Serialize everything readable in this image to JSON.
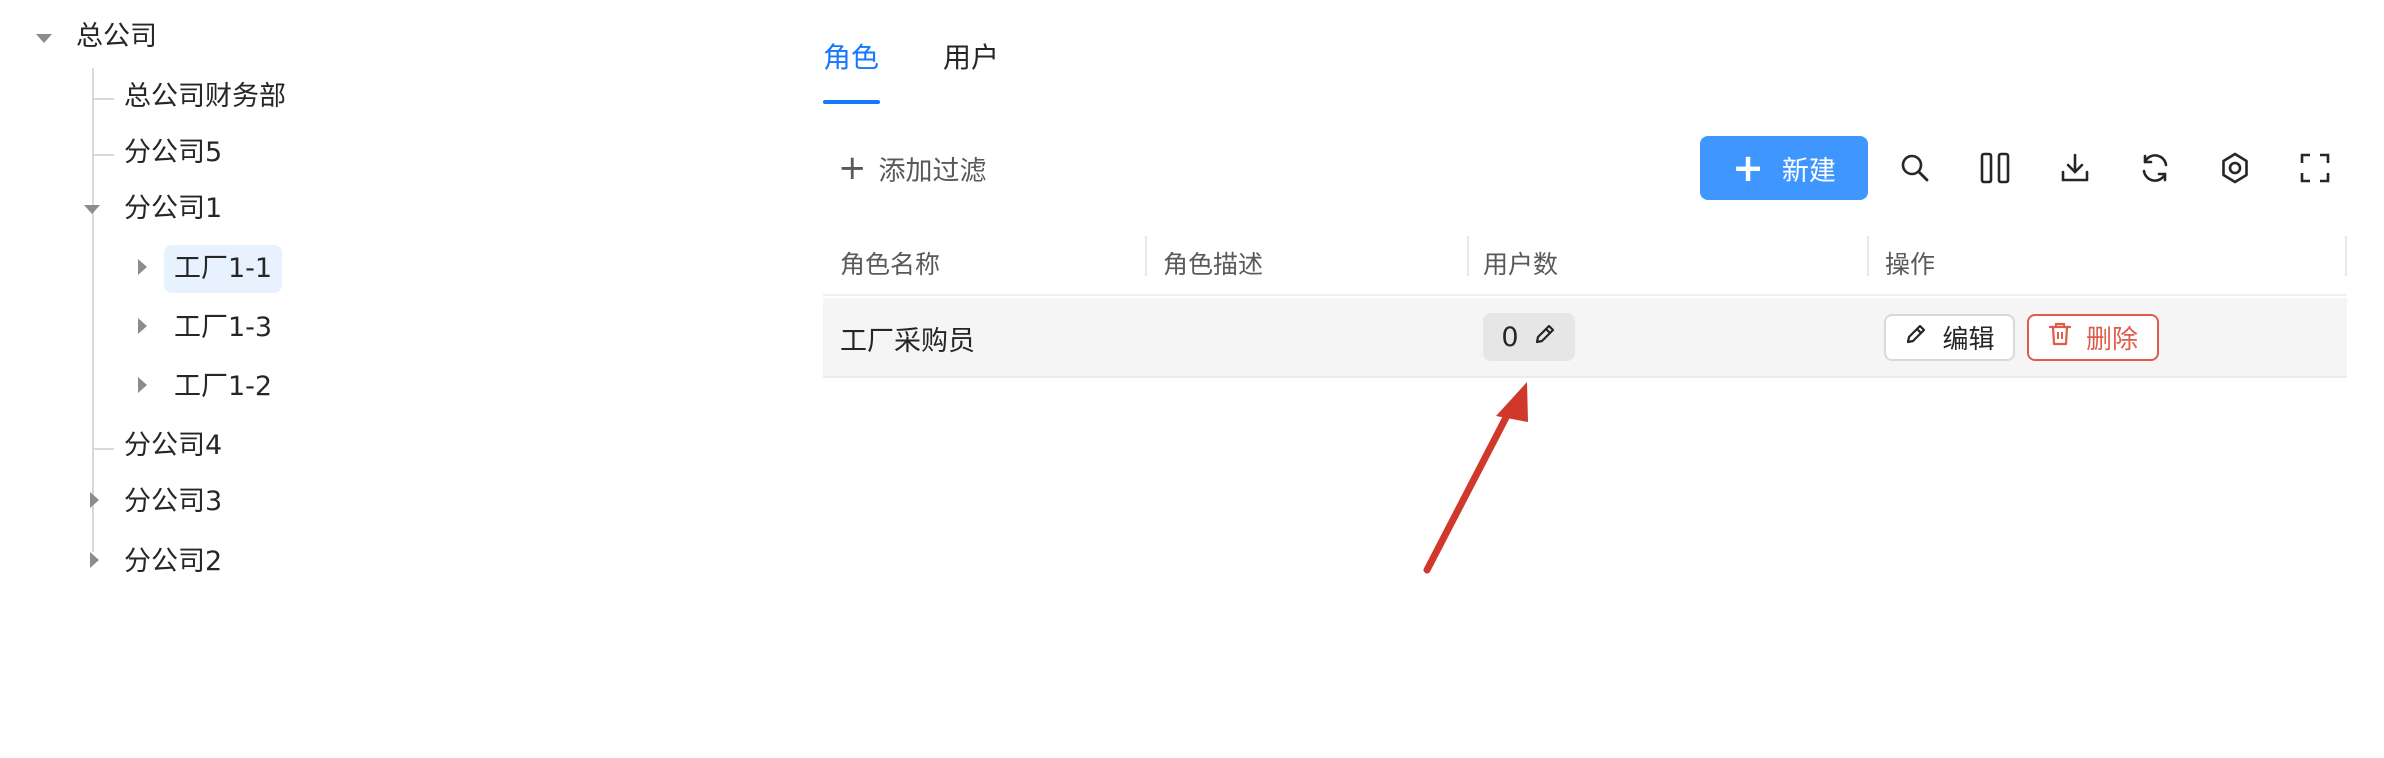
{
  "tree": {
    "root": {
      "label": "总公司"
    },
    "items": [
      {
        "label": "总公司财务部"
      },
      {
        "label": "分公司5"
      },
      {
        "label": "分公司1"
      },
      {
        "label": "工厂1-1"
      },
      {
        "label": "工厂1-3"
      },
      {
        "label": "工厂1-2"
      },
      {
        "label": "分公司4"
      },
      {
        "label": "分公司3"
      },
      {
        "label": "分公司2"
      }
    ],
    "selected": "工厂1-1"
  },
  "tabs": [
    {
      "label": "角色",
      "active": true
    },
    {
      "label": "用户",
      "active": false
    }
  ],
  "toolbar": {
    "add_filter_label": "添加过滤",
    "new_label": "新建",
    "icons": [
      "search-icon",
      "columns-icon",
      "download-icon",
      "refresh-icon",
      "settings-icon",
      "fullscreen-icon"
    ]
  },
  "table": {
    "columns": [
      "角色名称",
      "角色描述",
      "用户数",
      "操作"
    ],
    "rows": [
      {
        "name": "工厂采购员",
        "description": "",
        "user_count": "0",
        "edit_label": "编辑",
        "delete_label": "删除"
      }
    ]
  },
  "colors": {
    "accent": "#1677ff",
    "primary_button": "#4096ff",
    "danger": "#e05c4a",
    "annotation_arrow": "#d0382b"
  }
}
